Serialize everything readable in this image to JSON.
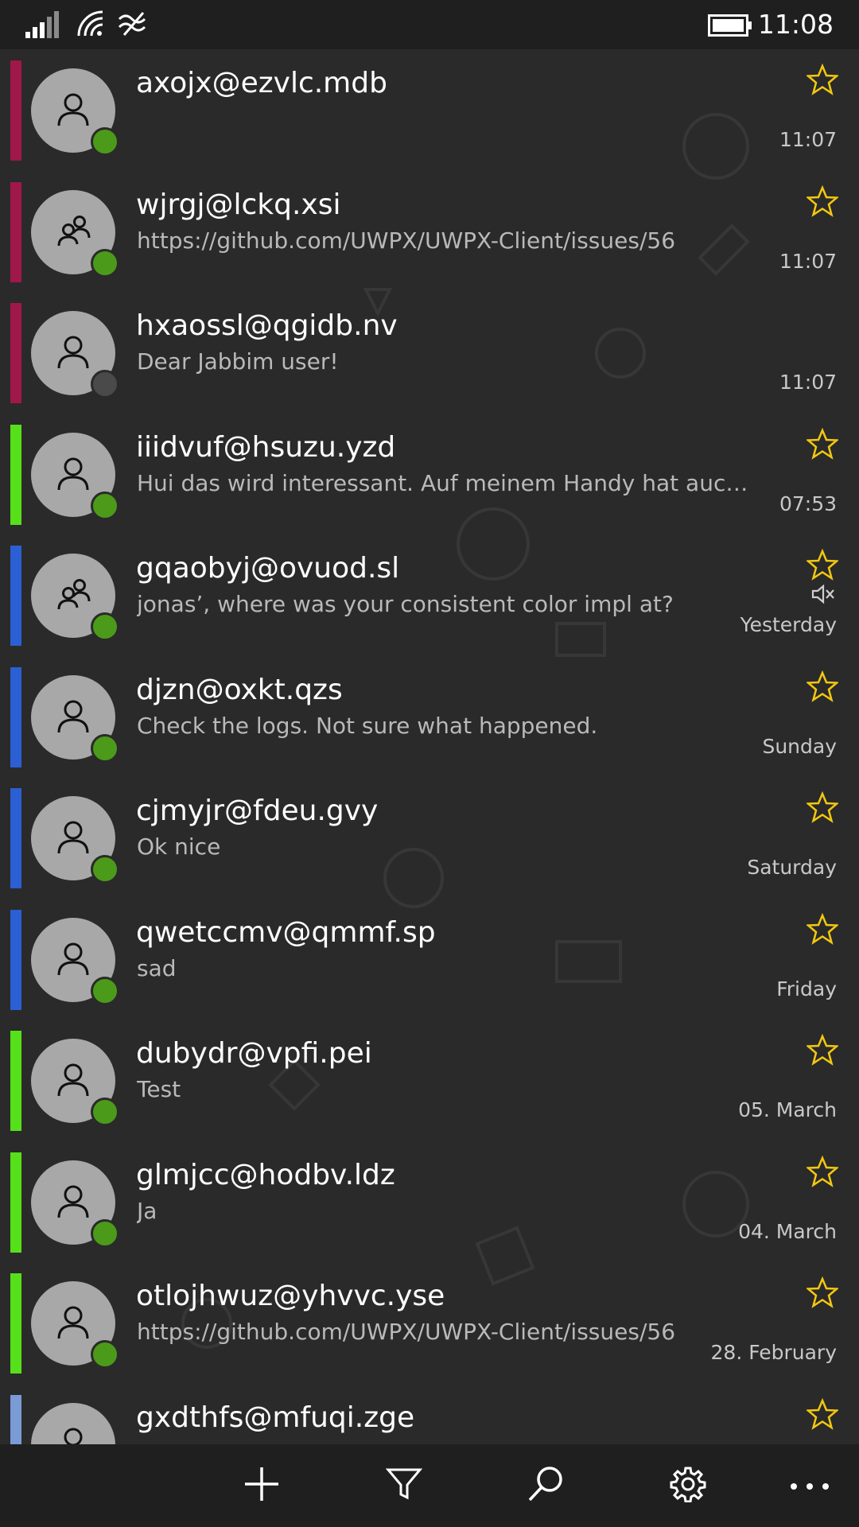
{
  "status_bar": {
    "time": "11:08",
    "icons": [
      "signal-icon",
      "wifi-icon",
      "data-sense-icon",
      "battery-icon"
    ]
  },
  "colors": {
    "accent_crimson": "#a0174a",
    "accent_green": "#56e01a",
    "accent_blue": "#2b5fd3",
    "accent_lightblue": "#7b9bd6",
    "presence_online": "#4c9a1a",
    "presence_offline": "#4a4a4a",
    "star": "#f2c811"
  },
  "chats": [
    {
      "name": "axojx@ezvlc.mdb",
      "preview": "",
      "time": "11:07",
      "accent": "crimson",
      "avatar": "person-icon",
      "presence": "online",
      "starred": true,
      "muted": false
    },
    {
      "name": "wjrgj@lckq.xsi",
      "preview": "https://github.com/UWPX/UWPX-Client/issues/56",
      "time": "11:07",
      "accent": "crimson",
      "avatar": "group-icon",
      "presence": "online",
      "starred": true,
      "muted": false
    },
    {
      "name": "hxaossl@qgidb.nv",
      "preview": "Dear Jabbim user!",
      "time": "11:07",
      "accent": "crimson",
      "avatar": "person-icon",
      "presence": "offline",
      "starred": false,
      "muted": false
    },
    {
      "name": "iiidvuf@hsuzu.yzd",
      "preview": "Hui das wird interessant. Auf meinem Handy hat auch...",
      "time": "07:53",
      "accent": "green",
      "avatar": "person-icon",
      "presence": "online",
      "starred": true,
      "muted": false
    },
    {
      "name": "gqaobyj@ovuod.sl",
      "preview": "jonas’, where was your consistent color impl at?",
      "time": "Yesterday",
      "accent": "blue",
      "avatar": "group-icon",
      "presence": "online",
      "starred": true,
      "muted": true
    },
    {
      "name": "djzn@oxkt.qzs",
      "preview": "Check the logs. Not sure what happened.",
      "time": "Sunday",
      "accent": "blue",
      "avatar": "person-icon",
      "presence": "online",
      "starred": true,
      "muted": false
    },
    {
      "name": "cjmyjr@fdeu.gvy",
      "preview": "Ok nice",
      "time": "Saturday",
      "accent": "blue",
      "avatar": "person-icon",
      "presence": "online",
      "starred": true,
      "muted": false
    },
    {
      "name": "qwetccmv@qmmf.sp",
      "preview": "sad",
      "time": "Friday",
      "accent": "blue",
      "avatar": "person-icon",
      "presence": "online",
      "starred": true,
      "muted": false
    },
    {
      "name": "dubydr@vpfi.pei",
      "preview": "Test",
      "time": "05. March",
      "accent": "green",
      "avatar": "person-icon",
      "presence": "online",
      "starred": true,
      "muted": false
    },
    {
      "name": "glmjcc@hodbv.ldz",
      "preview": "Ja",
      "time": "04. March",
      "accent": "green",
      "avatar": "person-icon",
      "presence": "online",
      "starred": true,
      "muted": false
    },
    {
      "name": "otlojhwuz@yhvvc.yse",
      "preview": "https://github.com/UWPX/UWPX-Client/issues/56",
      "time": "28. February",
      "accent": "green",
      "avatar": "person-icon",
      "presence": "online",
      "starred": true,
      "muted": false
    },
    {
      "name": "gxdthfs@mfuqi.zge",
      "preview": "",
      "time": "",
      "accent": "lightblue",
      "avatar": "person-icon",
      "presence": "online",
      "starred": true,
      "muted": false
    }
  ],
  "app_bar": {
    "buttons": [
      "add-icon",
      "filter-icon",
      "search-icon",
      "settings-icon",
      "more-icon"
    ]
  }
}
